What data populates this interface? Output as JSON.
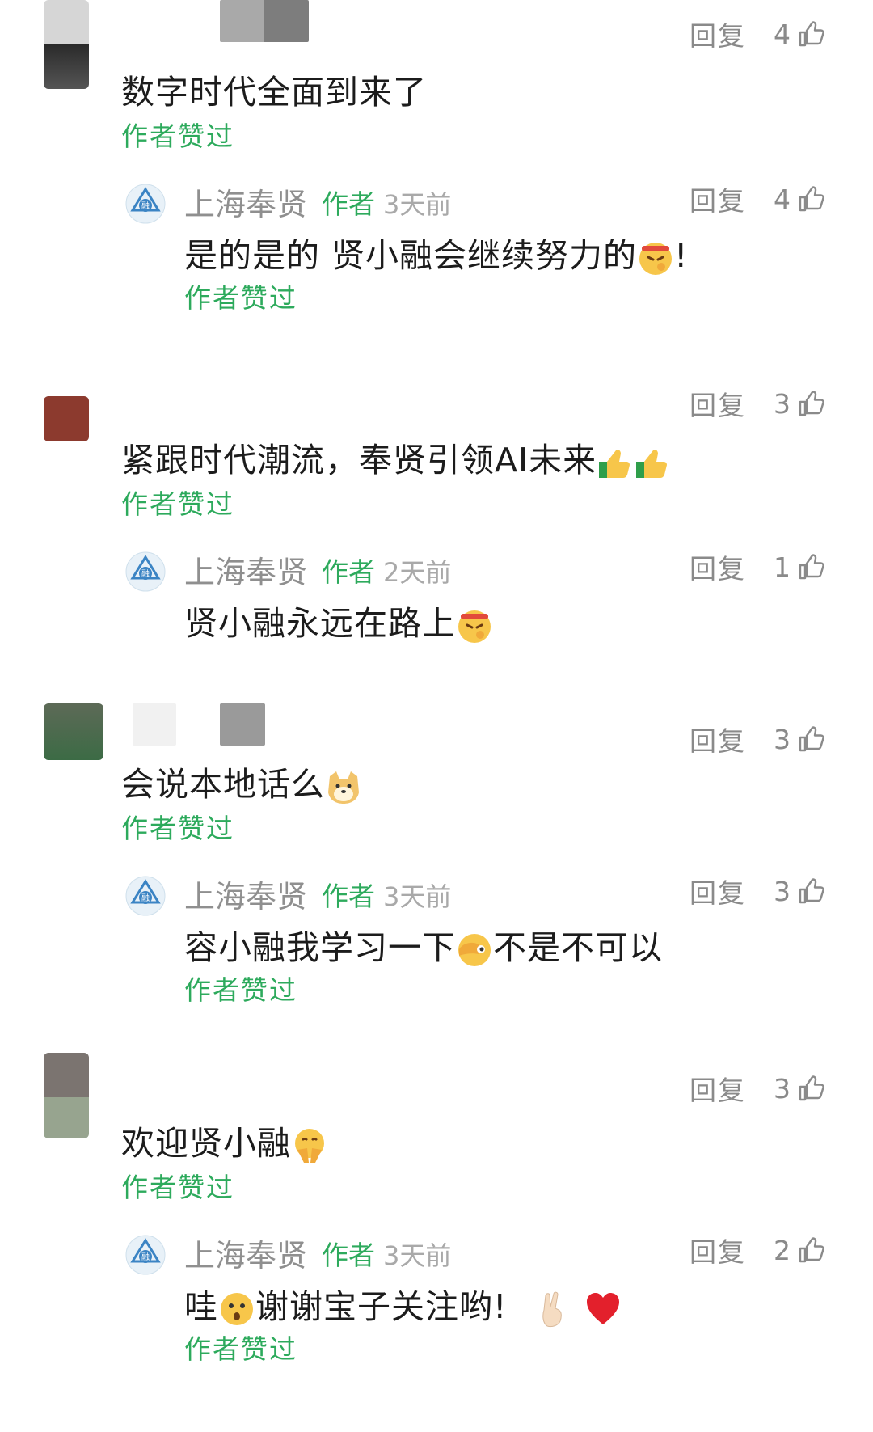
{
  "reply_label": "回复",
  "liked_by_author": "作者赞过",
  "author_badge": "作者",
  "author_name": "上海奉贤",
  "threads": [
    {
      "comment": {
        "text": "数字时代全面到来了",
        "likes": "4"
      },
      "reply": {
        "time": "3天前",
        "likes": "4",
        "text_before": "是的是的 贤小融会继续努力的",
        "text_after": "!",
        "emoji": "determined-face-emoji"
      }
    },
    {
      "comment": {
        "text": "紧跟时代潮流，奉贤引领AI未来",
        "likes": "3",
        "emoji": "thumbs-up-emoji"
      },
      "reply": {
        "time": "2天前",
        "likes": "1",
        "text_before": "贤小融永远在路上",
        "text_after": "",
        "emoji": "determined-face-emoji"
      }
    },
    {
      "comment": {
        "text": "会说本地话么",
        "likes": "3",
        "emoji": "doge-emoji"
      },
      "reply": {
        "time": "3天前",
        "likes": "3",
        "text_before": "容小融我学习一下",
        "text_after": "不是不可以",
        "emoji": "facepalm-peek-emoji"
      }
    },
    {
      "comment": {
        "text": "欢迎贤小融",
        "likes": "3",
        "emoji": "blush-hands-emoji"
      },
      "reply": {
        "time": "3天前",
        "likes": "2",
        "text_before": "哇",
        "text_mid": "谢谢宝子关注哟!",
        "emoji": "surprised-face-emoji",
        "trailing_emojis": [
          "crossed-fingers-emoji",
          "red-heart-emoji"
        ]
      }
    }
  ],
  "colors": {
    "liked_green": "#2daa5c",
    "meta_gray": "#8a8a8a",
    "heart_red": "#e3202c"
  }
}
